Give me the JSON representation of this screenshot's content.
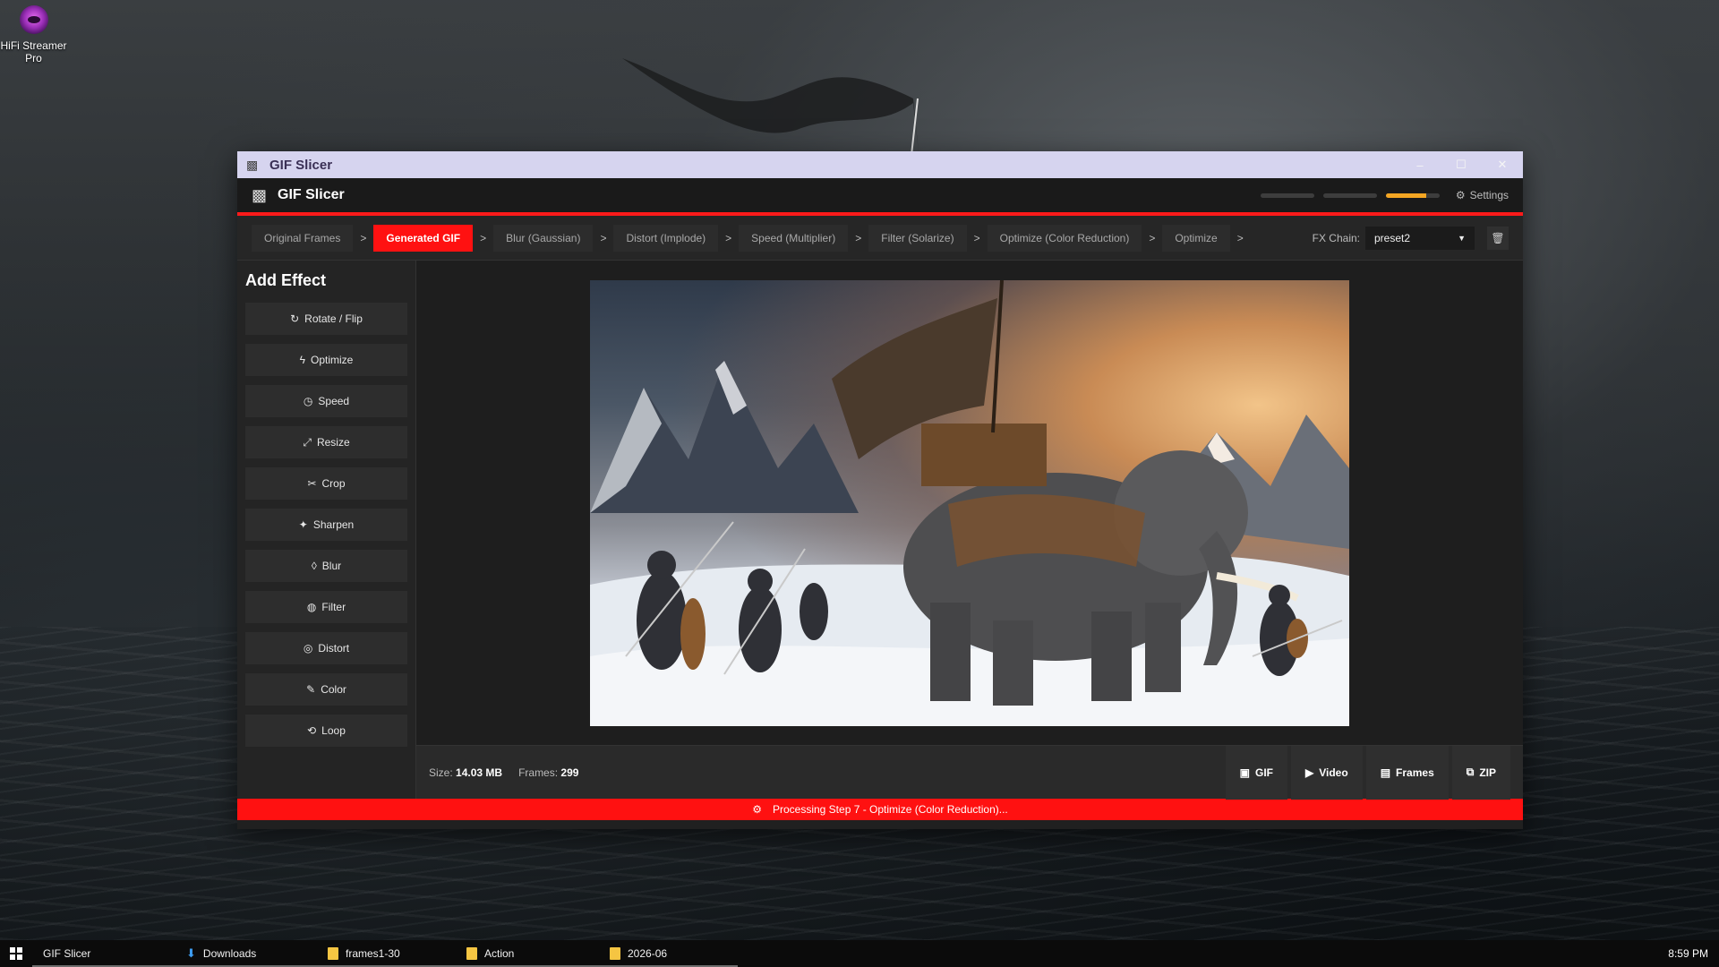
{
  "desktop": {
    "icon_label": "HiFi Streamer Pro"
  },
  "window": {
    "title": "GIF Slicer",
    "controls": [
      "–",
      "☐",
      "✕"
    ]
  },
  "header": {
    "title": "GIF Slicer",
    "settings_label": "Settings",
    "progress": [
      0,
      0,
      0.75
    ]
  },
  "pipeline": {
    "tabs": [
      {
        "label": "Original Frames",
        "active": false
      },
      {
        "label": "Generated GIF",
        "active": true
      },
      {
        "label": "Blur (Gaussian)",
        "active": false
      },
      {
        "label": "Distort (Implode)",
        "active": false
      },
      {
        "label": "Speed (Multiplier)",
        "active": false
      },
      {
        "label": "Filter (Solarize)",
        "active": false
      },
      {
        "label": "Optimize (Color Reduction)",
        "active": false
      },
      {
        "label": "Optimize",
        "active": false
      }
    ],
    "separator": ">",
    "fx_chain_label": "FX Chain:",
    "fx_chain_value": "preset2"
  },
  "sidebar": {
    "heading": "Add Effect",
    "effects": [
      {
        "label": "Rotate / Flip",
        "icon": "rotate-icon"
      },
      {
        "label": "Optimize",
        "icon": "lightning-icon"
      },
      {
        "label": "Speed",
        "icon": "stopwatch-icon"
      },
      {
        "label": "Resize",
        "icon": "resize-icon"
      },
      {
        "label": "Crop",
        "icon": "crop-icon"
      },
      {
        "label": "Sharpen",
        "icon": "sparkle-icon"
      },
      {
        "label": "Blur",
        "icon": "droplet-icon"
      },
      {
        "label": "Filter",
        "icon": "palette-icon"
      },
      {
        "label": "Distort",
        "icon": "target-icon"
      },
      {
        "label": "Color",
        "icon": "brush-icon"
      },
      {
        "label": "Loop",
        "icon": "loop-icon"
      }
    ]
  },
  "status": {
    "size_label": "Size:",
    "size_value": "14.03 MB",
    "frames_label": "Frames:",
    "frames_value": "299",
    "exports": [
      {
        "label": "GIF",
        "icon": "save-icon"
      },
      {
        "label": "Video",
        "icon": "video-icon"
      },
      {
        "label": "Frames",
        "icon": "image-icon"
      },
      {
        "label": "ZIP",
        "icon": "zip-icon"
      }
    ],
    "processing_text": "Processing Step 7 - Optimize (Color Reduction)..."
  },
  "taskbar": {
    "items": [
      {
        "label": "GIF Slicer",
        "icon": "none"
      },
      {
        "label": "Downloads",
        "icon": "download-icon"
      },
      {
        "label": "frames1-30",
        "icon": "folder-icon"
      },
      {
        "label": "Action",
        "icon": "folder-icon"
      },
      {
        "label": "2026-06",
        "icon": "folder-icon"
      }
    ],
    "clock": "8:59 PM"
  },
  "colors": {
    "accent": "#ff1111",
    "progress_fill": "#f5a623",
    "titlebar": "#d6d4ef"
  }
}
